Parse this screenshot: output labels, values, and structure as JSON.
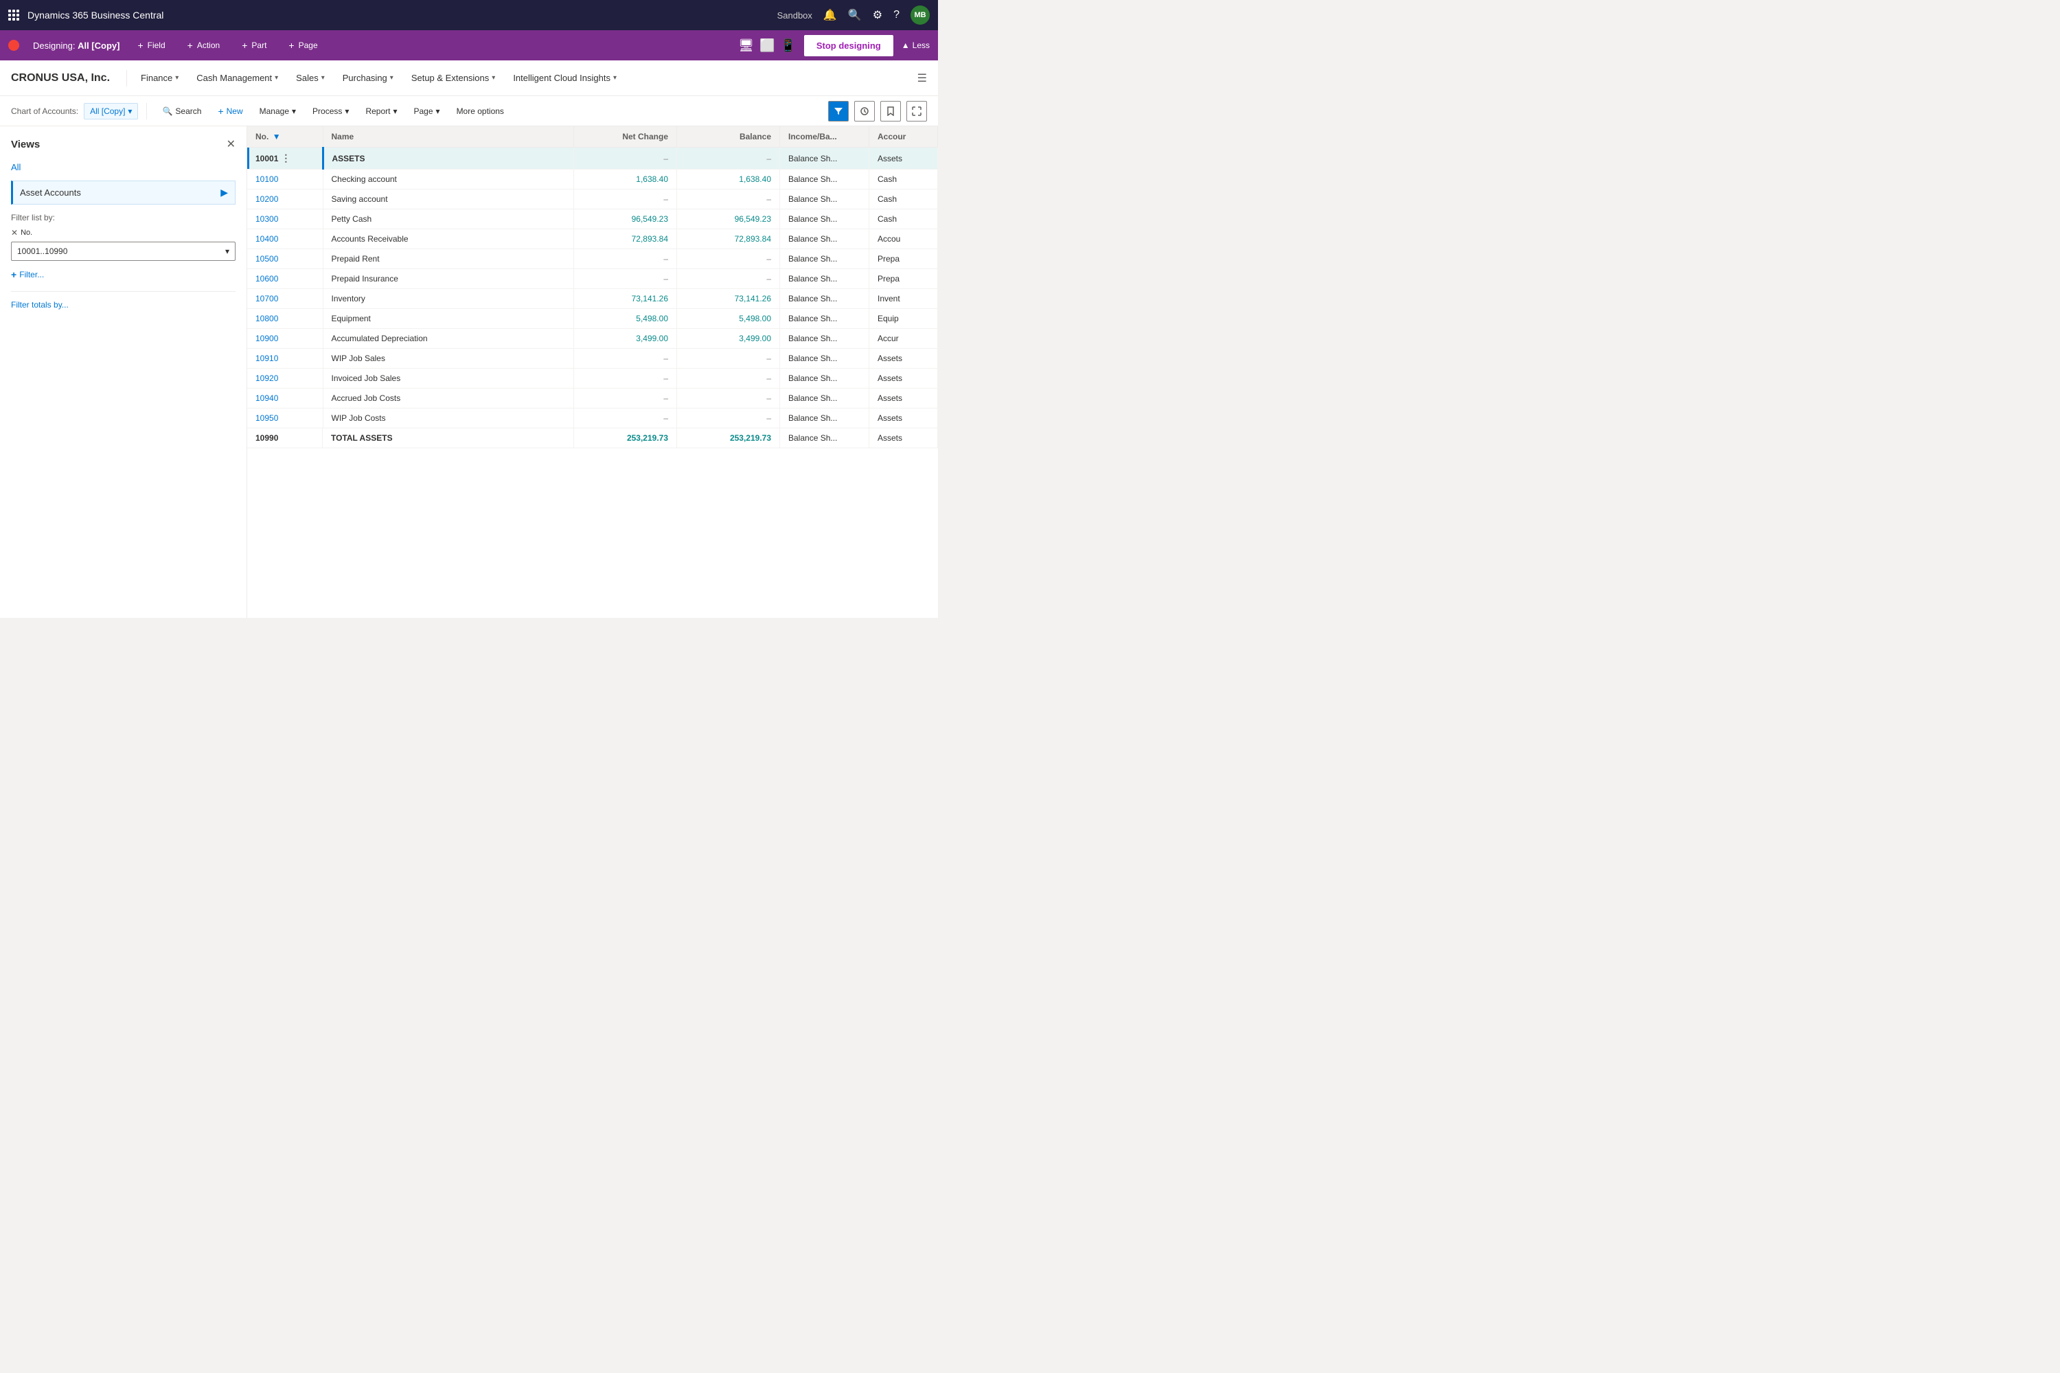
{
  "app": {
    "title": "Dynamics 365 Business Central",
    "environment": "Sandbox"
  },
  "design_bar": {
    "label": "Designing:",
    "view_name": "All [Copy]",
    "actions": [
      {
        "label": "Field",
        "icon": "+"
      },
      {
        "label": "Action",
        "icon": "+"
      },
      {
        "label": "Part",
        "icon": "+"
      },
      {
        "label": "Page",
        "icon": "+"
      }
    ],
    "stop_button": "Stop designing",
    "less_button": "Less"
  },
  "menu_bar": {
    "company": "CRONUS USA, Inc.",
    "items": [
      {
        "label": "Finance",
        "has_chevron": true
      },
      {
        "label": "Cash Management",
        "has_chevron": true
      },
      {
        "label": "Sales",
        "has_chevron": true
      },
      {
        "label": "Purchasing",
        "has_chevron": true
      },
      {
        "label": "Setup & Extensions",
        "has_chevron": true
      },
      {
        "label": "Intelligent Cloud Insights",
        "has_chevron": true
      }
    ]
  },
  "action_bar": {
    "breadcrumb_label": "Chart of Accounts:",
    "breadcrumb_value": "All [Copy]",
    "actions": [
      {
        "label": "Search",
        "icon": "🔍"
      },
      {
        "label": "New",
        "icon": "+"
      },
      {
        "label": "Manage",
        "icon": "",
        "has_chevron": true
      },
      {
        "label": "Process",
        "icon": "",
        "has_chevron": true
      },
      {
        "label": "Report",
        "icon": "",
        "has_chevron": true
      },
      {
        "label": "Page",
        "icon": "",
        "has_chevron": true
      },
      {
        "label": "More options",
        "icon": ""
      }
    ]
  },
  "views_panel": {
    "title": "Views",
    "view_all": "All",
    "active_view": "Asset Accounts",
    "filter_label": "Filter list by:",
    "filter_field": "No.",
    "filter_value": "10001..10990",
    "add_filter": "Filter...",
    "filter_totals": "Filter totals by..."
  },
  "table": {
    "columns": [
      {
        "key": "no",
        "label": "No.",
        "has_filter": true
      },
      {
        "key": "name",
        "label": "Name"
      },
      {
        "key": "net_change",
        "label": "Net Change",
        "align": "right"
      },
      {
        "key": "balance",
        "label": "Balance",
        "align": "right"
      },
      {
        "key": "income_ba",
        "label": "Income/Ba...",
        "align": "left"
      },
      {
        "key": "accour",
        "label": "Accour",
        "align": "left"
      }
    ],
    "rows": [
      {
        "no": "10001",
        "name": "ASSETS",
        "net_change": "–",
        "balance": "–",
        "income_ba": "Balance Sh...",
        "accour": "Assets",
        "is_category": true,
        "is_bold": true,
        "highlighted": true
      },
      {
        "no": "10100",
        "name": "Checking account",
        "net_change": "1,638.40",
        "balance": "1,638.40",
        "income_ba": "Balance Sh...",
        "accour": "Cash",
        "is_link": true,
        "has_menu": false
      },
      {
        "no": "10200",
        "name": "Saving account",
        "net_change": "–",
        "balance": "–",
        "income_ba": "Balance Sh...",
        "accour": "Cash",
        "is_link": true
      },
      {
        "no": "10300",
        "name": "Petty Cash",
        "net_change": "96,549.23",
        "balance": "96,549.23",
        "income_ba": "Balance Sh...",
        "accour": "Cash",
        "is_link": true
      },
      {
        "no": "10400",
        "name": "Accounts Receivable",
        "net_change": "72,893.84",
        "balance": "72,893.84",
        "income_ba": "Balance Sh...",
        "accour": "Accou",
        "is_link": true
      },
      {
        "no": "10500",
        "name": "Prepaid Rent",
        "net_change": "–",
        "balance": "–",
        "income_ba": "Balance Sh...",
        "accour": "Prepa",
        "is_link": true
      },
      {
        "no": "10600",
        "name": "Prepaid Insurance",
        "net_change": "–",
        "balance": "–",
        "income_ba": "Balance Sh...",
        "accour": "Prepa",
        "is_link": true
      },
      {
        "no": "10700",
        "name": "Inventory",
        "net_change": "73,141.26",
        "balance": "73,141.26",
        "income_ba": "Balance Sh...",
        "accour": "Invent",
        "is_link": true
      },
      {
        "no": "10800",
        "name": "Equipment",
        "net_change": "5,498.00",
        "balance": "5,498.00",
        "income_ba": "Balance Sh...",
        "accour": "Equip",
        "is_link": true
      },
      {
        "no": "10900",
        "name": "Accumulated Depreciation",
        "net_change": "3,499.00",
        "balance": "3,499.00",
        "income_ba": "Balance Sh...",
        "accour": "Accur",
        "is_link": true
      },
      {
        "no": "10910",
        "name": "WIP Job Sales",
        "net_change": "–",
        "balance": "–",
        "income_ba": "Balance Sh...",
        "accour": "Assets",
        "is_link": true
      },
      {
        "no": "10920",
        "name": "Invoiced Job Sales",
        "net_change": "–",
        "balance": "–",
        "income_ba": "Balance Sh...",
        "accour": "Assets",
        "is_link": true
      },
      {
        "no": "10940",
        "name": "Accrued Job Costs",
        "net_change": "–",
        "balance": "–",
        "income_ba": "Balance Sh...",
        "accour": "Assets",
        "is_link": true
      },
      {
        "no": "10950",
        "name": "WIP Job Costs",
        "net_change": "–",
        "balance": "–",
        "income_ba": "Balance Sh...",
        "accour": "Assets",
        "is_link": true
      },
      {
        "no": "10990",
        "name": "TOTAL ASSETS",
        "net_change": "253,219.73",
        "balance": "253,219.73",
        "income_ba": "Balance Sh...",
        "accour": "Assets",
        "is_bold": true
      }
    ]
  },
  "user": {
    "initials": "MB",
    "avatar_color": "#2d7d32"
  }
}
